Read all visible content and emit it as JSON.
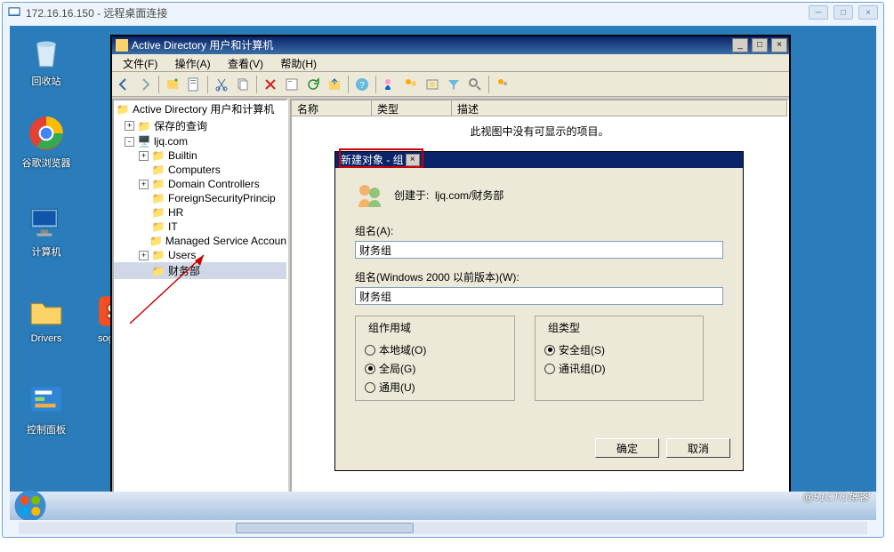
{
  "outer": {
    "title": "172.16.16.150 - 远程桌面连接",
    "btn_min": "─",
    "btn_max": "□",
    "btn_close": "×"
  },
  "desktop_icons": {
    "recycle": "回收站",
    "chrome": "谷歌浏览器",
    "computer": "计算机",
    "drivers": "Drivers",
    "sogou": "sogou_",
    "control": "控制面板"
  },
  "ad": {
    "title": "Active Directory 用户和计算机",
    "menu": [
      "文件(F)",
      "操作(A)",
      "查看(V)",
      "帮助(H)"
    ],
    "tree": {
      "root": "Active Directory 用户和计算机",
      "saved": "保存的查询",
      "domain": "ljq.com",
      "children": [
        "Builtin",
        "Computers",
        "Domain Controllers",
        "ForeignSecurityPrincip",
        "HR",
        "IT",
        "Managed Service Accoun",
        "Users",
        "财务部"
      ]
    },
    "cols": {
      "name": "名称",
      "type": "类型",
      "desc": "描述"
    },
    "empty": "此视图中没有可显示的项目。"
  },
  "dlg": {
    "title": "新建对象 - 组",
    "created_in_lab": "创建于:",
    "created_in_val": "ljq.com/财务部",
    "name_lab": "组名(A):",
    "name_val": "财务组",
    "name2000_lab": "组名(Windows 2000 以前版本)(W):",
    "name2000_val": "财务组",
    "scope_legend": "组作用域",
    "scope": {
      "local": "本地域(O)",
      "global": "全局(G)",
      "universal": "通用(U)"
    },
    "type_legend": "组类型",
    "type": {
      "security": "安全组(S)",
      "dist": "通讯组(D)"
    },
    "ok": "确定",
    "cancel": "取消",
    "close": "×"
  },
  "watermark": "@51CTO博客"
}
